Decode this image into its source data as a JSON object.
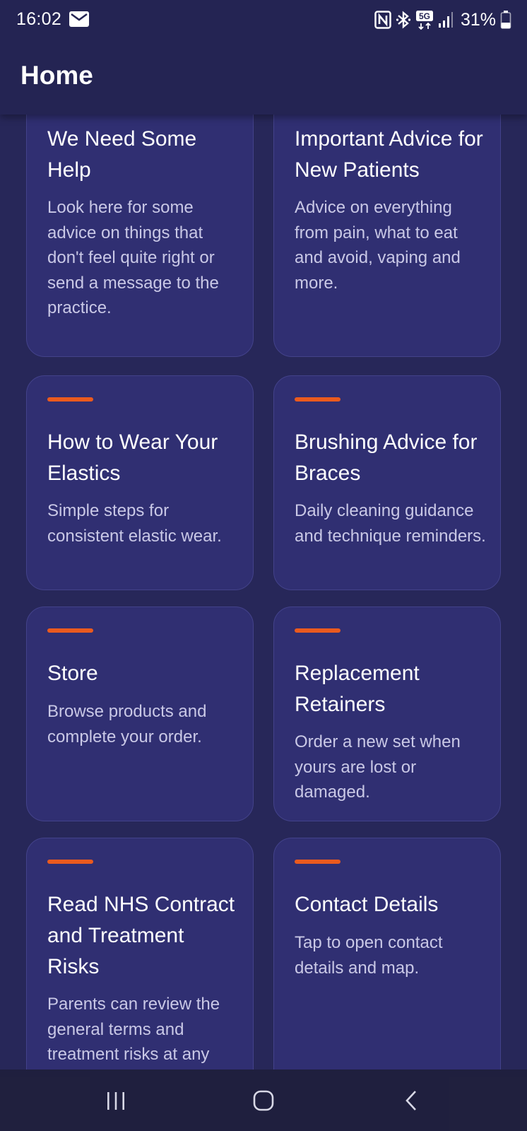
{
  "status_bar": {
    "time": "16:02",
    "battery": "31%",
    "icons": [
      "mail-icon",
      "nfc-icon",
      "bluetooth-icon",
      "5g-icon",
      "signal-icon",
      "battery-icon"
    ]
  },
  "header": {
    "title": "Home"
  },
  "cards": [
    {
      "title": "We Need Some Help",
      "description": "Look here for some advice on things that don't feel quite right or send a message to the practice."
    },
    {
      "title": "Important Advice for New Patients",
      "description": "Advice on everything from pain, what to eat and avoid, vaping and more."
    },
    {
      "title": "How to Wear Your Elastics",
      "description": "Simple steps for consistent elastic wear."
    },
    {
      "title": "Brushing Advice for Braces",
      "description": "Daily cleaning guidance and technique reminders."
    },
    {
      "title": "Store",
      "description": "Browse products and complete your order."
    },
    {
      "title": "Replacement Retainers",
      "description": "Order a new set when yours are lost or damaged."
    },
    {
      "title": "Read NHS Contract and Treatment Risks",
      "description": "Parents can review the general terms and treatment risks at any time."
    },
    {
      "title": "Contact Details",
      "description": "Tap to open contact details and map."
    }
  ],
  "colors": {
    "background": "#272759",
    "header": "#242453",
    "card": "#302f72",
    "accent": "#ea5a1e",
    "description_text": "#c9c8e6"
  },
  "nav_bar": {
    "icons": [
      "recent-apps-icon",
      "home-icon",
      "back-icon"
    ]
  }
}
